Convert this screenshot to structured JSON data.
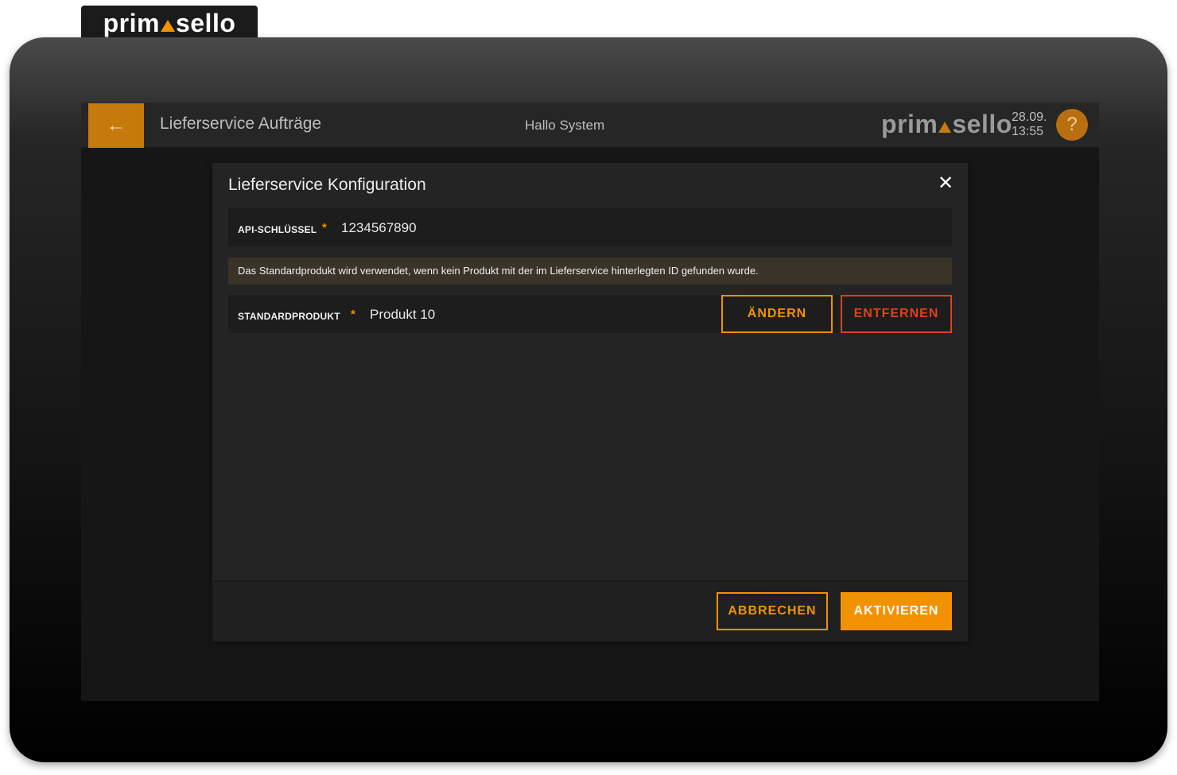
{
  "brand": {
    "logo_left": "prim",
    "logo_right": "sello"
  },
  "topbar": {
    "back_icon": "arrow-left-icon",
    "title": "Lieferservice Aufträge",
    "greeting": "Hallo System",
    "date": "28.09.",
    "time": "13:55",
    "help_label": "?"
  },
  "dialog": {
    "title": "Lieferservice Konfiguration",
    "close_label": "✕",
    "api_key": {
      "label": "API-SCHLÜSSEL",
      "required_mark": "*",
      "value": "1234567890"
    },
    "info_text": "Das Standardprodukt wird verwendet, wenn kein Produkt mit der im Lieferservice hinterlegten ID gefunden wurde.",
    "default_product": {
      "label": "STANDARDPRODUKT",
      "required_mark": "*",
      "value": "Produkt 10",
      "change_label": "ÄNDERN",
      "remove_label": "ENTFERNEN"
    },
    "footer": {
      "cancel_label": "ABBRECHEN",
      "activate_label": "AKTIVIEREN"
    }
  },
  "colors": {
    "accent": "#f39200",
    "danger": "#e2401c",
    "back_button": "#c77a0c",
    "dialog_bg": "#242424",
    "screen_bg": "#161616"
  }
}
